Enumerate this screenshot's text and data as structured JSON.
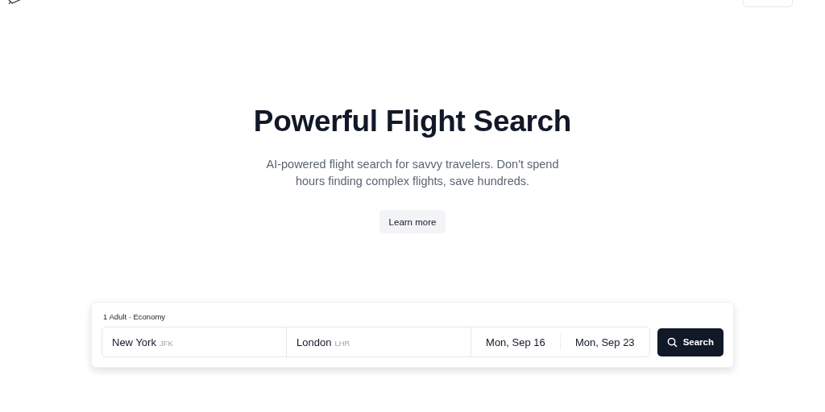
{
  "hero": {
    "title": "Powerful Flight Search",
    "subtitle": "AI-powered flight search for savvy travelers. Don't spend hours finding complex flights, save hundreds.",
    "button": "Learn more"
  },
  "search": {
    "passengers": "1 Adult · Economy",
    "fields": [
      {
        "kind": "place",
        "city": "New York",
        "code": "JFK"
      },
      {
        "kind": "place",
        "city": "London",
        "code": "LHR"
      },
      {
        "kind": "date",
        "value": "Mon, Sep 16"
      },
      {
        "kind": "date",
        "value": "Mon, Sep 23"
      }
    ],
    "button": "Search"
  }
}
